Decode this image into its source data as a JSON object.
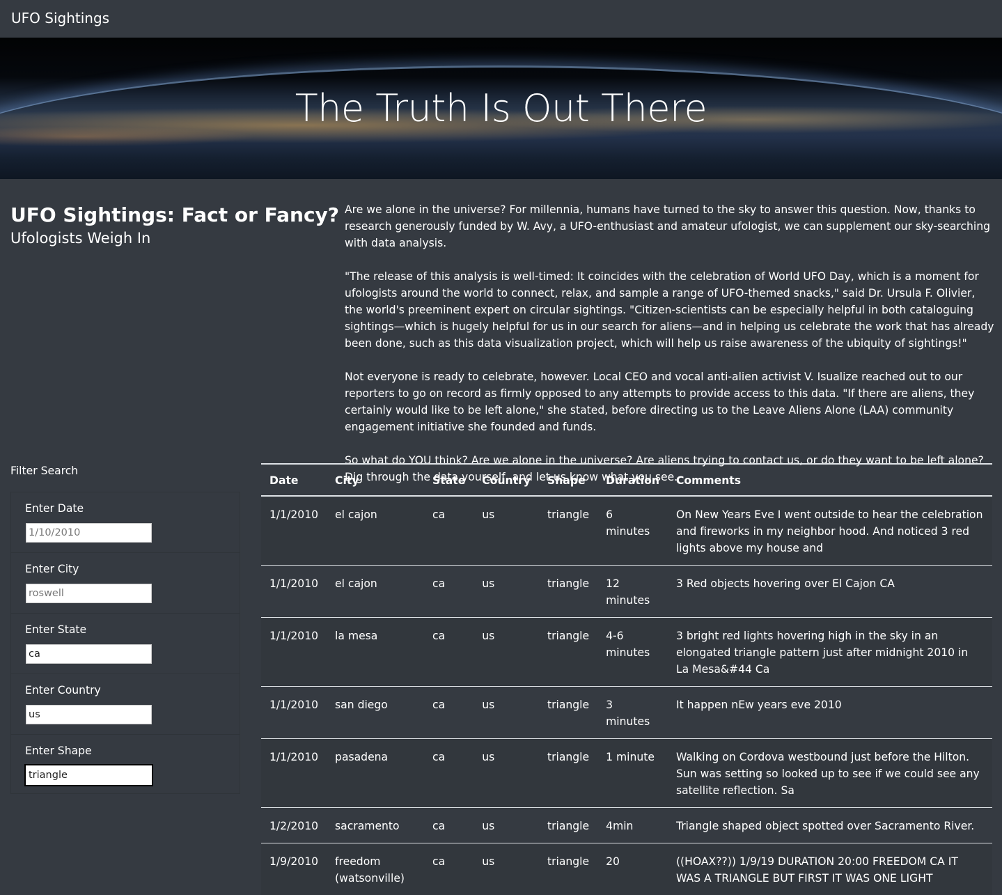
{
  "nav": {
    "brand": "UFO Sightings"
  },
  "hero": {
    "title": "The Truth Is Out There"
  },
  "intro": {
    "heading": "UFO Sightings: Fact or Fancy?",
    "subheading": "Ufologists Weigh In",
    "paragraphs": [
      "Are we alone in the universe? For millennia, humans have turned to the sky to answer this question. Now, thanks to research generously funded by W. Avy, a UFO-enthusiast and amateur ufologist, we can supplement our sky-searching with data analysis.",
      "\"The release of this analysis is well-timed: It coincides with the celebration of World UFO Day, which is a moment for ufologists around the world to connect, relax, and sample a range of UFO-themed snacks,\" said Dr. Ursula F. Olivier, the world's preeminent expert on circular sightings. \"Citizen-scientists can be especially helpful in both cataloguing sightings—which is hugely helpful for us in our search for aliens—and in helping us celebrate the work that has already been done, such as this data visualization project, which will help us raise awareness of the ubiquity of sightings!\"",
      "Not everyone is ready to celebrate, however. Local CEO and vocal anti-alien activist V. Isualize reached out to our reporters to go on record as firmly opposed to any attempts to provide access to this data. \"If there are aliens, they certainly would like to be left alone,\" she stated, before directing us to the Leave Aliens Alone (LAA) community engagement initiative she founded and funds.",
      "So what do YOU think? Are we alone in the universe? Are aliens trying to contact us, or do they want to be left alone? Dig through the data yourself, and let us know what you see."
    ]
  },
  "filters": {
    "title": "Filter Search",
    "items": [
      {
        "label": "Enter Date",
        "value": "",
        "placeholder": "1/10/2010"
      },
      {
        "label": "Enter City",
        "value": "",
        "placeholder": "roswell"
      },
      {
        "label": "Enter State",
        "value": "ca",
        "placeholder": ""
      },
      {
        "label": "Enter Country",
        "value": "us",
        "placeholder": ""
      },
      {
        "label": "Enter Shape",
        "value": "triangle",
        "placeholder": ""
      }
    ]
  },
  "table": {
    "headers": [
      "Date",
      "City",
      "State",
      "Country",
      "Shape",
      "Duration",
      "Comments"
    ],
    "rows": [
      [
        "1/1/2010",
        "el cajon",
        "ca",
        "us",
        "triangle",
        "6 minutes",
        "On New Years Eve I went outside to hear the celebration and fireworks in my neighbor hood. And noticed 3 red lights above my house and"
      ],
      [
        "1/1/2010",
        "el cajon",
        "ca",
        "us",
        "triangle",
        "12 minutes",
        "3 Red objects hovering over El Cajon CA"
      ],
      [
        "1/1/2010",
        "la mesa",
        "ca",
        "us",
        "triangle",
        "4-6 minutes",
        "3 bright red lights hovering high in the sky in an elongated triangle pattern just after midnight 2010 in La Mesa&#44 Ca"
      ],
      [
        "1/1/2010",
        "san diego",
        "ca",
        "us",
        "triangle",
        "3 minutes",
        "It happen nEw years eve 2010"
      ],
      [
        "1/1/2010",
        "pasadena",
        "ca",
        "us",
        "triangle",
        "1 minute",
        "Walking on Cordova westbound just before the Hilton. Sun was setting so looked up to see if we could see any satellite reflection. Sa"
      ],
      [
        "1/2/2010",
        "sacramento",
        "ca",
        "us",
        "triangle",
        "4min",
        "Triangle shaped object spotted over Sacramento River."
      ],
      [
        "1/9/2010",
        "freedom (watsonville)",
        "ca",
        "us",
        "triangle",
        "20",
        "((HOAX??)) 1/9/19 DURATION 20:00 FREEDOM CA IT WAS A TRIANGLE BUT FIRST IT WAS ONE LIGHT"
      ]
    ]
  }
}
